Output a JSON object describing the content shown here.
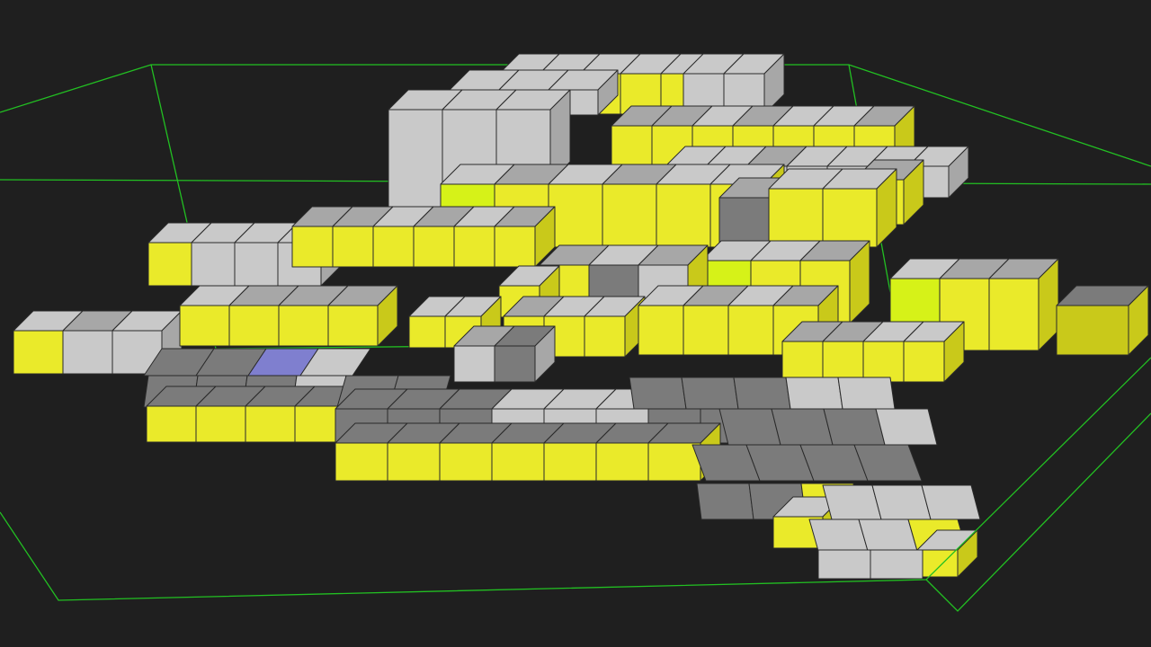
{
  "scene": {
    "background": "#1f1f1f",
    "bounds_color": "#22c022",
    "palette": {
      "tile_light": "#c9c9c9",
      "tile_mid": "#a7a7a7",
      "tile_dark": "#7b7b7b",
      "glass_front": "#eaea2a",
      "glass_side": "#c9c91a",
      "glass_bright": "#d6f218",
      "cursor_tile": "#7f7fcf"
    }
  }
}
